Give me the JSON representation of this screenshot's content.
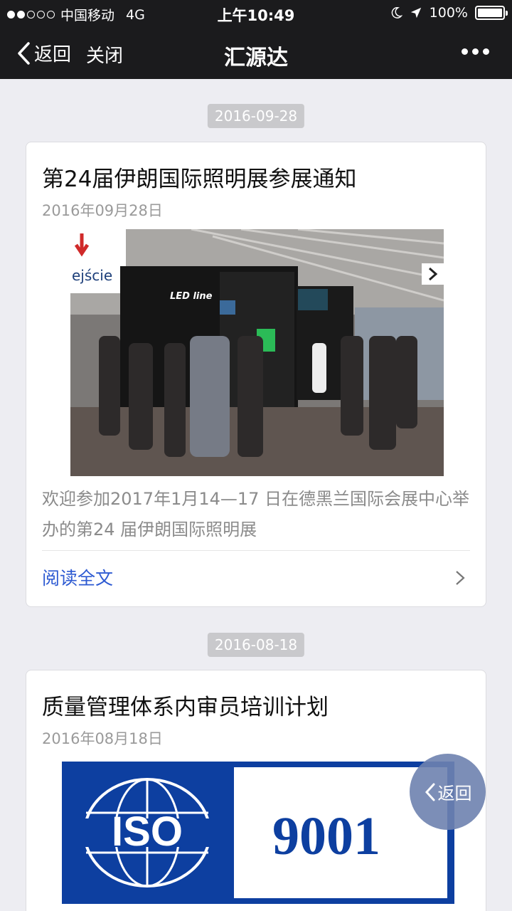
{
  "status_bar": {
    "carrier": "中国移动",
    "network": "4G",
    "time": "上午10:49",
    "battery": "100%"
  },
  "nav": {
    "back_label": "返回",
    "close_label": "关闭",
    "title": "汇源达"
  },
  "feed": [
    {
      "chip_date": "2016-09-28",
      "title": "第24届伊朗国际照明展参展通知",
      "date": "2016年09月28日",
      "photo_texts": {
        "sign": "ejście",
        "brand": "LED line"
      },
      "summary": "欢迎参加2017年1月14—17 日在德黑兰国际会展中心举办的第24 届伊朗国际照明展",
      "read_more": "阅读全文"
    },
    {
      "chip_date": "2016-08-18",
      "title": "质量管理体系内审员培训计划",
      "date": "2016年08月18日",
      "logo": {
        "left": "ISO",
        "right": "9001"
      }
    }
  ],
  "floating_back_label": "返回",
  "colors": {
    "nav_bg": "#1b1b1d",
    "link": "#2d5ad2",
    "iso_blue": "#0d3fa0"
  }
}
